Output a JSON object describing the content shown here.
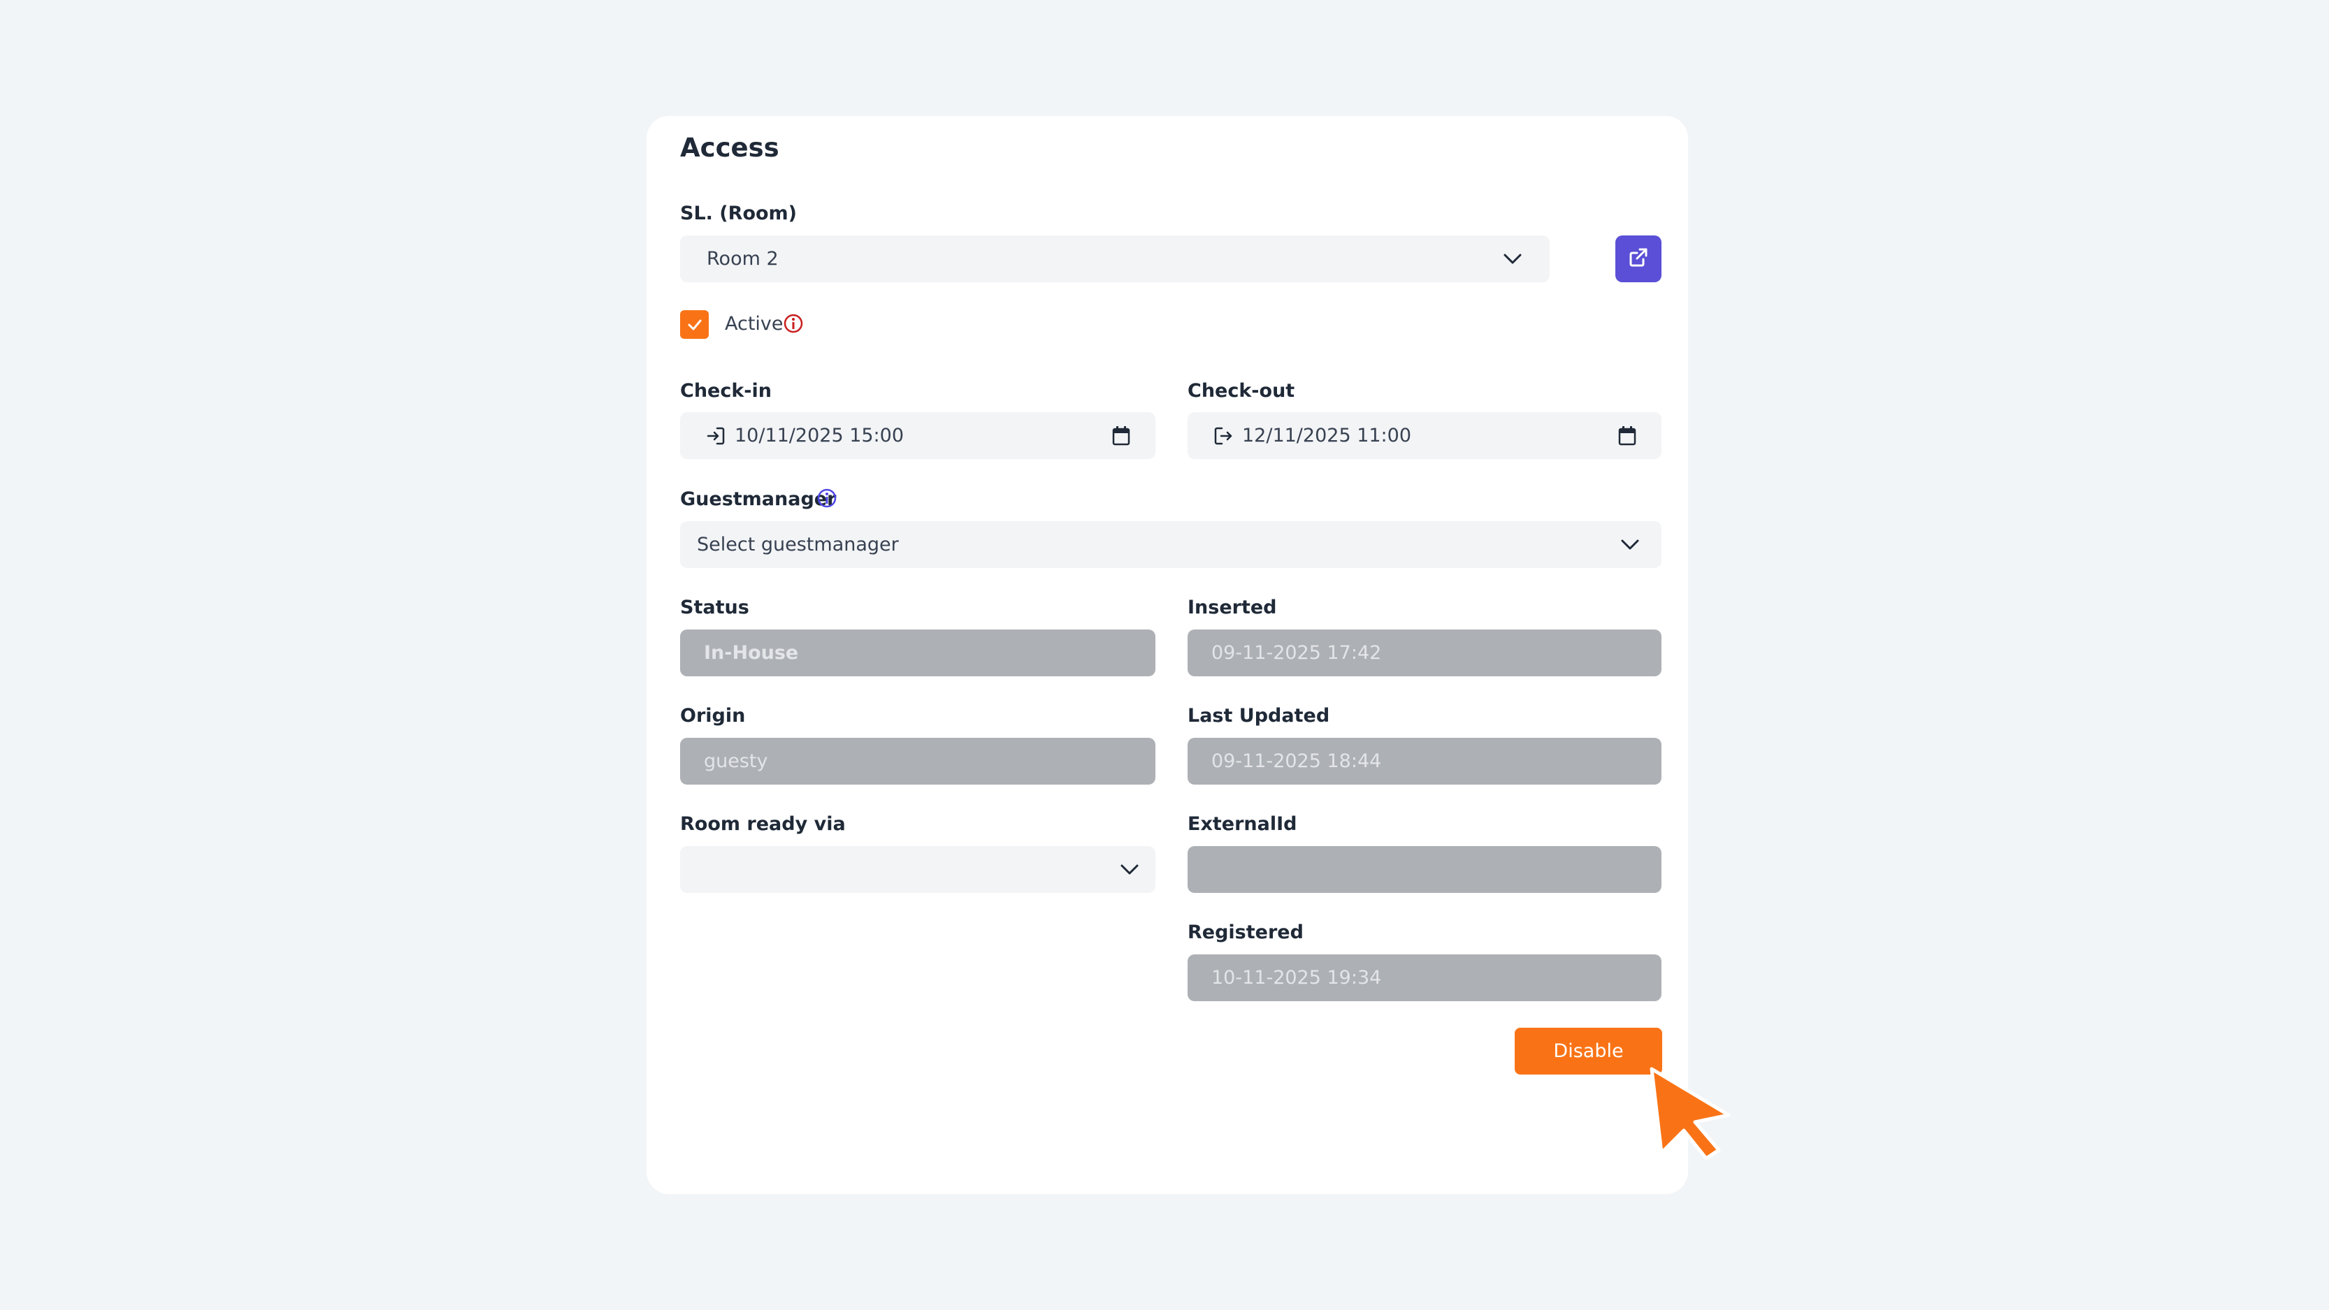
{
  "card": {
    "title": "Access"
  },
  "room": {
    "label": "SL. (Room)",
    "value": "Room 2",
    "open_icon": "external-link-icon"
  },
  "active": {
    "label": "Active",
    "checked": true,
    "info_icon": "info-icon"
  },
  "checkin": {
    "label": "Check-in",
    "value": "10/11/2025 15:00",
    "icon": "login-icon"
  },
  "checkout": {
    "label": "Check-out",
    "value": "12/11/2025 11:00",
    "icon": "logout-icon"
  },
  "guestmanager": {
    "label": "Guestmanager",
    "placeholder": "Select guestmanager",
    "info_icon": "info-icon"
  },
  "status": {
    "label": "Status",
    "value": "In-House"
  },
  "inserted": {
    "label": "Inserted",
    "value": "09-11-2025 17:42"
  },
  "origin": {
    "label": "Origin",
    "value": "guesty"
  },
  "last_updated": {
    "label": "Last Updated",
    "value": "09-11-2025 18:44"
  },
  "room_ready_via": {
    "label": "Room ready via",
    "value": ""
  },
  "external_id": {
    "label": "ExternalId",
    "value": ""
  },
  "registered": {
    "label": "Registered",
    "value": "10-11-2025 19:34"
  },
  "actions": {
    "disable_label": "Disable"
  },
  "colors": {
    "accent_orange": "#f97316",
    "accent_purple": "#5a4fd6",
    "disabled_field": "#adb0b4",
    "info_red": "#c81e1e",
    "info_blue": "#4f46e5"
  }
}
